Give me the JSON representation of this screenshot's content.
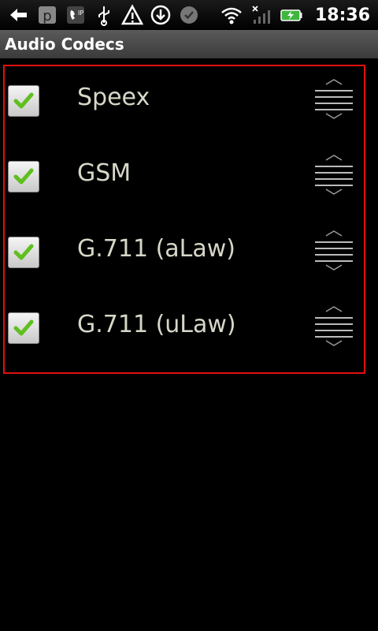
{
  "status_bar": {
    "time": "18:36",
    "icons_left": [
      "back-arrow-icon",
      "parking-app-icon",
      "sip-call-icon",
      "usb-icon",
      "warning-icon",
      "download-icon",
      "chat-icon"
    ],
    "icons_right": [
      "wifi-icon",
      "no-signal-icon",
      "battery-charging-icon"
    ]
  },
  "title_bar": {
    "title": "Audio Codecs"
  },
  "codecs": [
    {
      "label": "Speex",
      "checked": true
    },
    {
      "label": "GSM",
      "checked": true
    },
    {
      "label": "G.711 (aLaw)",
      "checked": true
    },
    {
      "label": "G.711 (uLaw)",
      "checked": true
    }
  ],
  "colors": {
    "highlight_border": "#e01010",
    "label_text": "#d7d7c8",
    "check_green": "#5fbf1f"
  }
}
